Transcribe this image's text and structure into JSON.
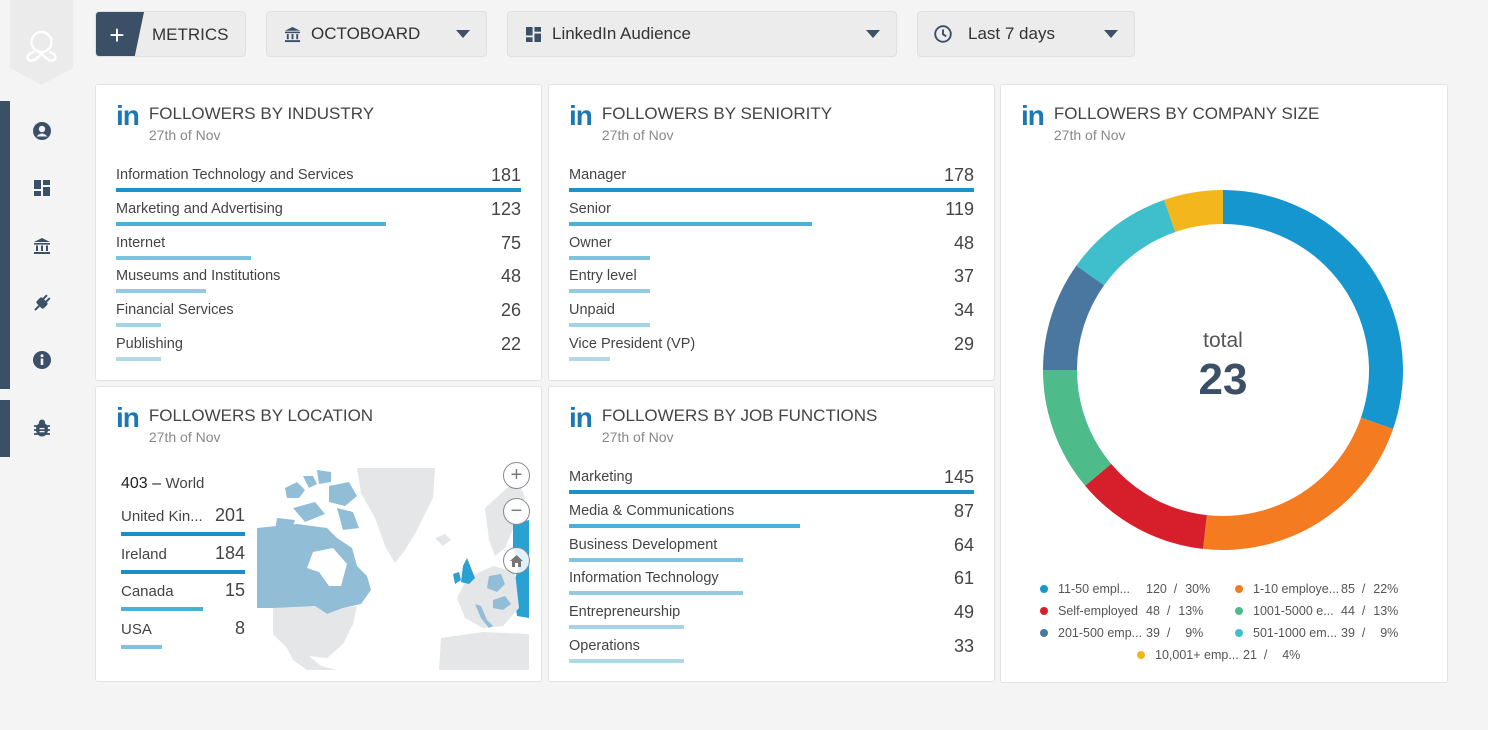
{
  "sidebar": {
    "items": [
      {
        "name": "profile",
        "icon": "user-circle-icon"
      },
      {
        "name": "dashboards",
        "icon": "dashboard-grid-icon"
      },
      {
        "name": "organizations",
        "icon": "bank-icon"
      },
      {
        "name": "integrations",
        "icon": "plug-icon"
      },
      {
        "name": "info",
        "icon": "info-circle-icon"
      },
      {
        "name": "report-bug",
        "icon": "bug-icon"
      }
    ]
  },
  "toolbar": {
    "metrics_label": "METRICS",
    "metrics_plus": "+",
    "org_label": "OCTOBOARD",
    "dashboard_label": "LinkedIn Audience",
    "period_label": "Last 7 days"
  },
  "colors": {
    "accent": "#3b4f66",
    "linkedin": "#1b78b5",
    "bar_shades": [
      "#1a94c8",
      "#4cb0d6",
      "#7dc2de",
      "#92cbe1",
      "#a3d3e5",
      "#b0d9e8"
    ]
  },
  "industry": {
    "title": "FOLLOWERS BY INDUSTRY",
    "date": "27th of Nov",
    "rows": [
      {
        "label": "Information Technology and Services",
        "value": "181",
        "fraction": 1.0
      },
      {
        "label": "Marketing and Advertising",
        "value": "123",
        "fraction": 0.667
      },
      {
        "label": "Internet",
        "value": "75",
        "fraction": 0.333
      },
      {
        "label": "Museums and Institutions",
        "value": "48",
        "fraction": 0.222
      },
      {
        "label": "Financial Services",
        "value": "26",
        "fraction": 0.111
      },
      {
        "label": "Publishing",
        "value": "22",
        "fraction": 0.111
      }
    ]
  },
  "seniority": {
    "title": "FOLLOWERS BY SENIORITY",
    "date": "27th of Nov",
    "rows": [
      {
        "label": "Manager",
        "value": "178",
        "fraction": 1.0
      },
      {
        "label": "Senior",
        "value": "119",
        "fraction": 0.6
      },
      {
        "label": "Owner",
        "value": "48",
        "fraction": 0.2
      },
      {
        "label": "Entry level",
        "value": "37",
        "fraction": 0.2
      },
      {
        "label": "Unpaid",
        "value": "34",
        "fraction": 0.2
      },
      {
        "label": "Vice President (VP)",
        "value": "29",
        "fraction": 0.1
      }
    ]
  },
  "location": {
    "title": "FOLLOWERS BY LOCATION",
    "date": "27th of Nov",
    "total_value": "403",
    "total_label": "World",
    "rows": [
      {
        "label": "United Kin...",
        "value": "201",
        "fraction": 1.0
      },
      {
        "label": "Ireland",
        "value": "184",
        "fraction": 1.0
      },
      {
        "label": "Canada",
        "value": "15",
        "fraction": 0.66
      },
      {
        "label": "USA",
        "value": "8",
        "fraction": 0.33
      }
    ],
    "map_controls": {
      "zoom_in": "+",
      "zoom_out": "−"
    }
  },
  "job_functions": {
    "title": "FOLLOWERS BY JOB FUNCTIONS",
    "date": "27th of Nov",
    "rows": [
      {
        "label": "Marketing",
        "value": "145",
        "fraction": 1.0
      },
      {
        "label": "Media & Communications",
        "value": "87",
        "fraction": 0.57
      },
      {
        "label": "Business Development",
        "value": "64",
        "fraction": 0.43
      },
      {
        "label": "Information Technology",
        "value": "61",
        "fraction": 0.43
      },
      {
        "label": "Entrepreneurship",
        "value": "49",
        "fraction": 0.285
      },
      {
        "label": "Operations",
        "value": "33",
        "fraction": 0.285
      }
    ]
  },
  "company_size": {
    "title": "FOLLOWERS BY COMPANY SIZE",
    "date": "27th of Nov",
    "total_label": "total",
    "total_value": "23"
  },
  "chart_data": {
    "type": "pie",
    "title": "FOLLOWERS BY COMPANY SIZE",
    "subtitle": "27th of Nov",
    "center_label": "total",
    "center_value": "23",
    "legend_position": "bottom",
    "slices": [
      {
        "name": "11-50 empl...",
        "value": 120,
        "percent": "30%",
        "color": "#1596cf"
      },
      {
        "name": "1-10 employe...",
        "value": 85,
        "percent": "22%",
        "color": "#f47b20"
      },
      {
        "name": "Self-employed",
        "value": 48,
        "percent": "13%",
        "color": "#d71f2b"
      },
      {
        "name": "1001-5000 e...",
        "value": 44,
        "percent": "13%",
        "color": "#4dbb8a"
      },
      {
        "name": "201-500 emp...",
        "value": 39,
        "percent": "9%",
        "color": "#4a77a0"
      },
      {
        "name": "501-1000 em...",
        "value": 39,
        "percent": "9%",
        "color": "#3fbfcb"
      },
      {
        "name": "10,001+ emp...",
        "value": 21,
        "percent": "4%",
        "color": "#f3b71d"
      }
    ]
  }
}
